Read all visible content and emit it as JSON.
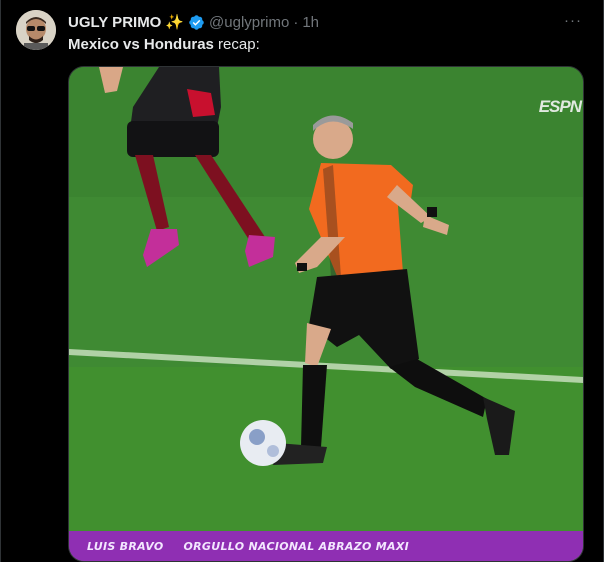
{
  "author": {
    "display_name": "UGLY PRIMO",
    "emoji": "✨",
    "handle": "@uglyprimo",
    "separator": "·",
    "time": "1h",
    "verified": true
  },
  "more_label": "···",
  "tweet": {
    "text_bold": "Mexico vs Honduras",
    "text_rest": " recap:"
  },
  "media": {
    "broadcaster": "ESPN",
    "lower_third_name": "LUIS BRAVO",
    "lower_third_caption": "ORGULLO NACIONAL ABRAZO MAXI"
  },
  "colors": {
    "pitch": "#3f8a33",
    "referee_shirt": "#f26a1f",
    "lower_third": "#8f2fb3",
    "verified": "#1d9bf0"
  }
}
